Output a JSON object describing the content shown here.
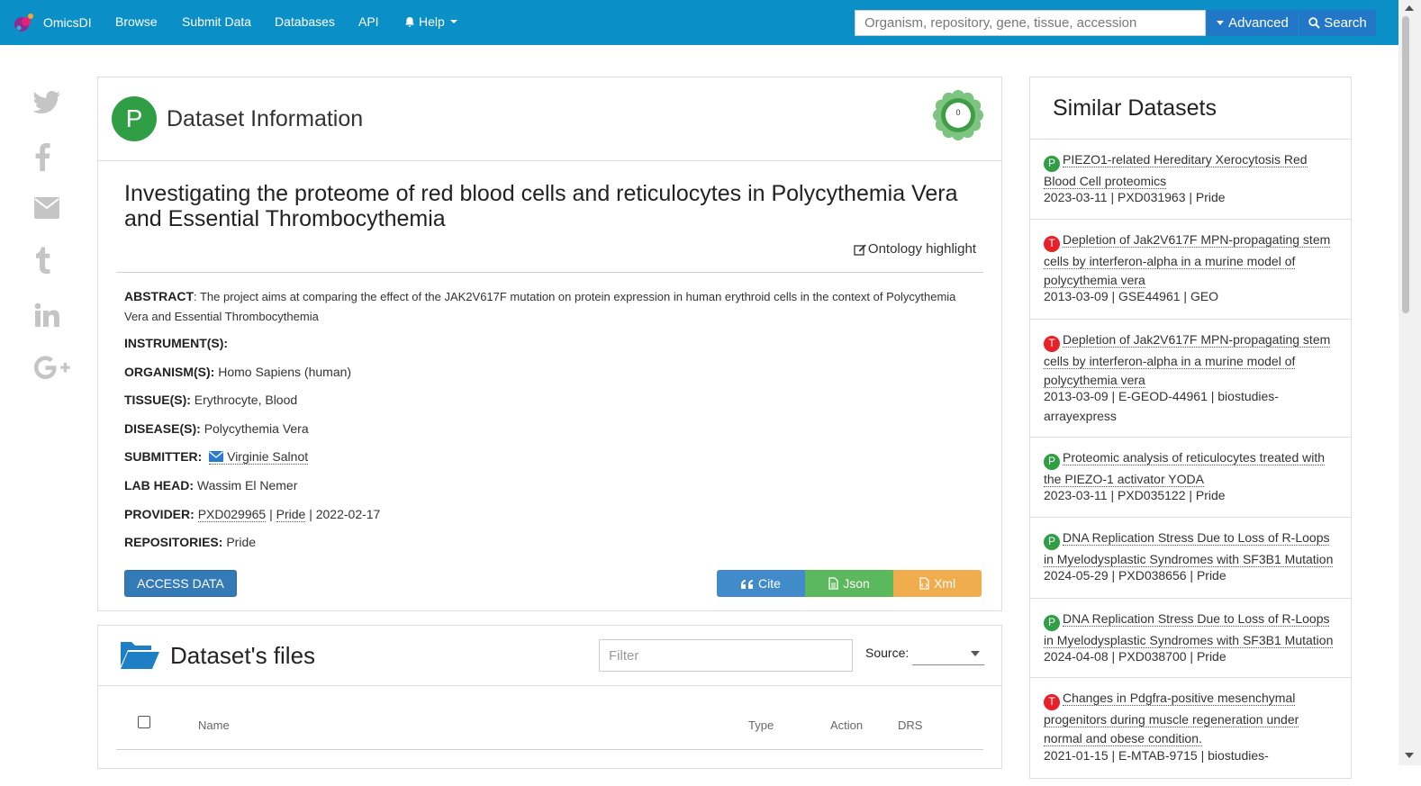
{
  "nav": {
    "brand": "OmicsDI",
    "links": [
      "Browse",
      "Submit Data",
      "Databases",
      "API",
      "Help"
    ],
    "search_placeholder": "Organism, repository, gene, tissue, accession",
    "advanced_label": "Advanced",
    "search_label": "Search"
  },
  "share": {
    "icons": [
      "twitter-icon",
      "facebook-icon",
      "email-icon",
      "tumblr-icon",
      "linkedin-icon",
      "google-plus-icon"
    ]
  },
  "info": {
    "badge": "P",
    "header": "Dataset Information",
    "score": "0",
    "title": "Investigating the proteome of red blood cells and reticulocytes in Polycythemia Vera and Essential Thrombocythemia",
    "ontology": "Ontology highlight",
    "abstract_label": "ABSTRACT",
    "abstract": ": The project aims at comparing the effect of the JAK2V617F mutation on protein expression in human erythroid cells in the context of Polycythemia Vera and Essential Thrombocythemia",
    "instrument_label": "INSTRUMENT(S):",
    "organism_label": "ORGANISM(S):",
    "organism": "Homo Sapiens (human)",
    "tissue_label": "TISSUE(S):",
    "tissue": "Erythrocyte, Blood",
    "disease_label": "DISEASE(S):",
    "disease": "Polycythemia Vera",
    "submitter_label": "SUBMITTER:",
    "submitter": "Virginie Salnot",
    "labhead_label": "LAB HEAD:",
    "labhead": "Wassim El Nemer",
    "provider_label": "PROVIDER:",
    "provider_acc": "PXD029965",
    "provider_sep1": " | ",
    "provider_repo": "Pride",
    "provider_sep2": " | 2022-02-17",
    "repos_label": "REPOSITORIES:",
    "repos": "Pride",
    "access_label": "ACCESS DATA",
    "cite_label": "Cite",
    "json_label": "Json",
    "xml_label": "Xml"
  },
  "files": {
    "title": "Dataset's files",
    "filter_placeholder": "Filter",
    "source_label": "Source:",
    "columns": [
      "Name",
      "Type",
      "Action",
      "DRS"
    ]
  },
  "similar": {
    "title": "Similar Datasets",
    "items": [
      {
        "badge": "P",
        "title": "PIEZO1-related Hereditary Xerocytosis Red Blood Cell proteomics",
        "meta": "2023-03-11 | PXD031963 | Pride"
      },
      {
        "badge": "T",
        "title": "Depletion of Jak2V617F MPN-propagating stem cells by interferon-alpha in a murine model of polycythemia vera",
        "meta": "2013-03-09 | GSE44961 | GEO"
      },
      {
        "badge": "T",
        "title": "Depletion of Jak2V617F MPN-propagating stem cells by interferon-alpha in a murine model of polycythemia vera",
        "meta": "2013-03-09 | E-GEOD-44961 | biostudies-arrayexpress"
      },
      {
        "badge": "P",
        "title": "Proteomic analysis of reticulocytes treated with the PIEZO-1 activator YODA",
        "meta": "2023-03-11 | PXD035122 | Pride"
      },
      {
        "badge": "P",
        "title": "DNA Replication Stress Due to Loss of R-Loops in Myelodysplastic Syndromes with SF3B1 Mutation",
        "meta": "2024-05-29 | PXD038656 | Pride"
      },
      {
        "badge": "P",
        "title": "DNA Replication Stress Due to Loss of R-Loops in Myelodysplastic Syndromes with SF3B1 Mutation",
        "meta": "2024-04-08 | PXD038700 | Pride"
      },
      {
        "badge": "T",
        "title": "Changes in Pdgfra-positive mesenchymal progenitors during muscle regeneration under normal and obese condition.",
        "meta": "2021-01-15 | E-MTAB-9715 | biostudies-"
      }
    ]
  },
  "colors": {
    "navbar": "#0b8fc7",
    "pride_badge": "#2f9e44",
    "geo_badge": "#e8202a",
    "access_button": "#337ab7",
    "cite_button": "#428bca",
    "json_button": "#5cb85c",
    "xml_button": "#f0ad4e"
  }
}
